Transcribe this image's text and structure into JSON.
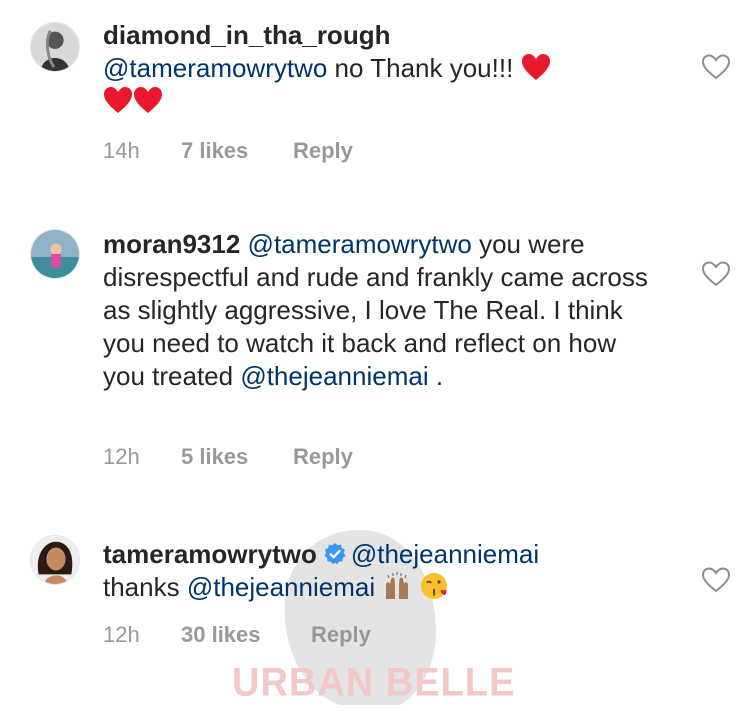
{
  "comments": [
    {
      "username": "diamond_in_tha_rough",
      "mention": "@tameramowrytwo",
      "text": " no Thank you!!! ",
      "time": "14h",
      "likes": "7 likes",
      "reply": "Reply"
    },
    {
      "username": "moran9312",
      "mention": "@tameramowrytwo",
      "text": " you were disrespectful and rude and frankly came across as slightly aggressive, I  love The Real.  I think you need to watch it back and reflect on how you treated ",
      "mention2": "@thejeanniemai",
      "text2": " .",
      "time": "12h",
      "likes": "5 likes",
      "reply": "Reply"
    },
    {
      "username": "tameramowrytwo",
      "mention": "@thejeanniemai",
      "text": "thanks ",
      "mention2": "@thejeanniemai",
      "time": "12h",
      "likes": "30 likes",
      "reply": "Reply"
    }
  ],
  "watermark": "URBAN BELLE",
  "colors": {
    "mention": "#003569",
    "meta": "#999999",
    "heart_red": "#e8192c",
    "verified": "#3897f0"
  },
  "icons": {
    "like": "heart-outline-icon",
    "verified": "verified-badge-icon"
  }
}
